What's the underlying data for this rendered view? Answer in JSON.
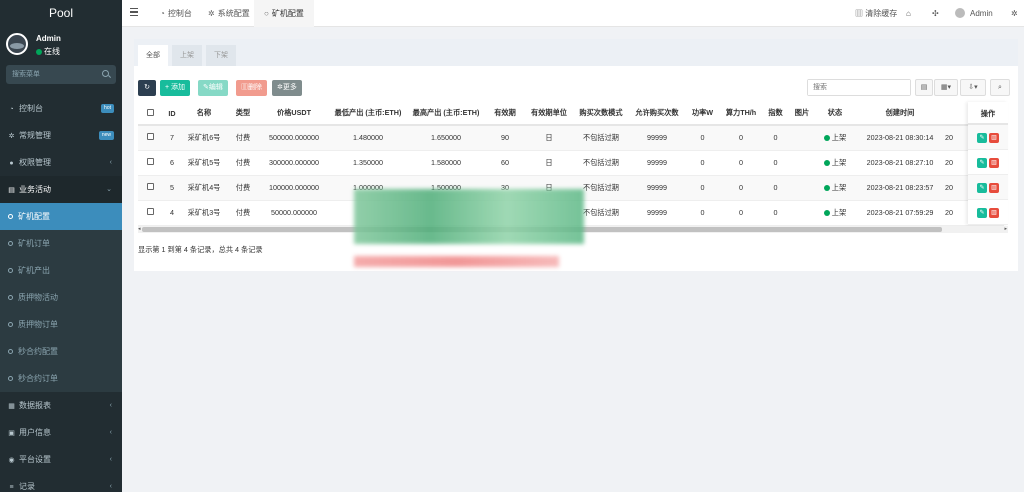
{
  "sidebar": {
    "brand": "Pool",
    "user": {
      "name": "Admin",
      "status": "在线"
    },
    "search_placeholder": "搜索菜单",
    "items": [
      {
        "label": "控制台",
        "icon": "dashboard-icon",
        "badge": "hot",
        "badge_color": "#3c8dbc"
      },
      {
        "label": "常规管理",
        "icon": "cogs-icon",
        "badge": "new",
        "badge_color": "#3c8dbc"
      },
      {
        "label": "权限管理",
        "icon": "group-icon"
      },
      {
        "label": "业务活动",
        "icon": "briefcase-icon"
      }
    ],
    "sub_items": [
      "矿机配置",
      "矿机订单",
      "矿机产出",
      "质押物活动",
      "质押物订单",
      "秒合约配置",
      "秒合约订单"
    ],
    "bottom_items": [
      {
        "label": "数据报表",
        "icon": "chart-icon"
      },
      {
        "label": "用户信息",
        "icon": "user-icon"
      },
      {
        "label": "平台设置",
        "icon": "settings-icon"
      },
      {
        "label": "记录",
        "icon": "list-icon"
      }
    ]
  },
  "topbar": {
    "tabs": [
      {
        "label": "控制台",
        "icon": "dashboard-icon"
      },
      {
        "label": "系统配置",
        "icon": "gear-icon"
      },
      {
        "label": "矿机配置",
        "icon": "circle-icon"
      }
    ],
    "clear_cache": "清除缓存",
    "user": "Admin"
  },
  "panel": {
    "tabs": [
      "全部",
      "上架",
      "下架"
    ],
    "toolbar": {
      "add": "添加",
      "edit": "编辑",
      "delete": "删除",
      "more": "更多"
    },
    "search_placeholder": "搜索",
    "columns": [
      "ID",
      "名称",
      "类型",
      "价格USDT",
      "最低产出 (主币:ETH)",
      "最高产出 (主币:ETH)",
      "有效期",
      "有效期单位",
      "购买次数模式",
      "允许购买次数",
      "功率W",
      "算力TH/h",
      "指数",
      "图片",
      "状态",
      "创建时间",
      "",
      "操作"
    ],
    "rows": [
      {
        "id": "7",
        "name": "采矿机6号",
        "type": "付费",
        "price": "500000.000000",
        "min": "1.480000",
        "max": "1.650000",
        "validity": "90",
        "unit": "日",
        "mode": "不包括过期",
        "allow": "99999",
        "power": "0",
        "hashrate": "0",
        "index": "0",
        "image": "",
        "status": "上架",
        "created": "2023-08-21 08:30:14",
        "extra": "20"
      },
      {
        "id": "6",
        "name": "采矿机5号",
        "type": "付费",
        "price": "300000.000000",
        "min": "1.350000",
        "max": "1.580000",
        "validity": "60",
        "unit": "日",
        "mode": "不包括过期",
        "allow": "99999",
        "power": "0",
        "hashrate": "0",
        "index": "0",
        "image": "",
        "status": "上架",
        "created": "2023-08-21 08:27:10",
        "extra": "20"
      },
      {
        "id": "5",
        "name": "采矿机4号",
        "type": "付费",
        "price": "100000.000000",
        "min": "1.000000",
        "max": "1.500000",
        "validity": "30",
        "unit": "日",
        "mode": "不包括过期",
        "allow": "99999",
        "power": "0",
        "hashrate": "0",
        "index": "0",
        "image": "",
        "status": "上架",
        "created": "2023-08-21 08:23:57",
        "extra": "20"
      },
      {
        "id": "4",
        "name": "采矿机3号",
        "type": "付费",
        "price": "50000.000000",
        "min": "",
        "max": "",
        "validity": "",
        "unit": "",
        "mode": "不包括过期",
        "allow": "99999",
        "power": "0",
        "hashrate": "0",
        "index": "0",
        "image": "",
        "status": "上架",
        "created": "2023-08-21 07:59:29",
        "extra": "20"
      }
    ],
    "summary": "显示第 1 到第 4 条记录，总共 4 条记录"
  },
  "colors": {
    "accent": "#3c8dbc",
    "success": "#00a65a",
    "danger": "#dd4b39",
    "teal": "#18bc9c"
  }
}
